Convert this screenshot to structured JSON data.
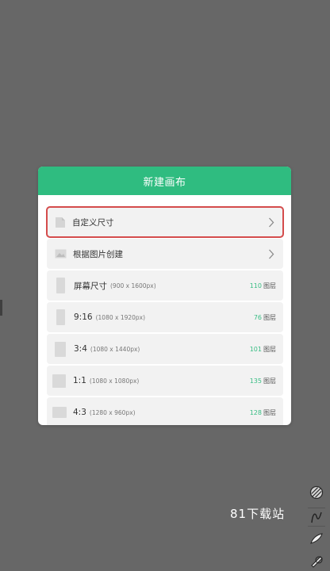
{
  "dialog": {
    "title": "新建画布",
    "custom_size_label": "自定义尺寸",
    "from_image_label": "根据图片创建",
    "presets": [
      {
        "label": "屏幕尺寸",
        "dims": "(900 x 1600px)",
        "count": "110",
        "layers": "图层"
      },
      {
        "label": "9:16",
        "dims": "(1080 x 1920px)",
        "count": "76",
        "layers": "图层"
      },
      {
        "label": "3:4",
        "dims": "(1080 x 1440px)",
        "count": "101",
        "layers": "图层"
      },
      {
        "label": "1:1",
        "dims": "(1080 x 1080px)",
        "count": "135",
        "layers": "图层"
      },
      {
        "label": "4:3",
        "dims": "(1280 x 960px)",
        "count": "128",
        "layers": "图层"
      }
    ]
  },
  "watermark": "81下载站",
  "tools": [
    "no-fill-icon",
    "curve-brush-icon",
    "leaf-brush-icon",
    "pen-brush-icon"
  ],
  "colors": {
    "header": "#2fbc80",
    "count_green": "#39bd84",
    "highlight_red": "#d44c4c",
    "backdrop": "#676767"
  }
}
